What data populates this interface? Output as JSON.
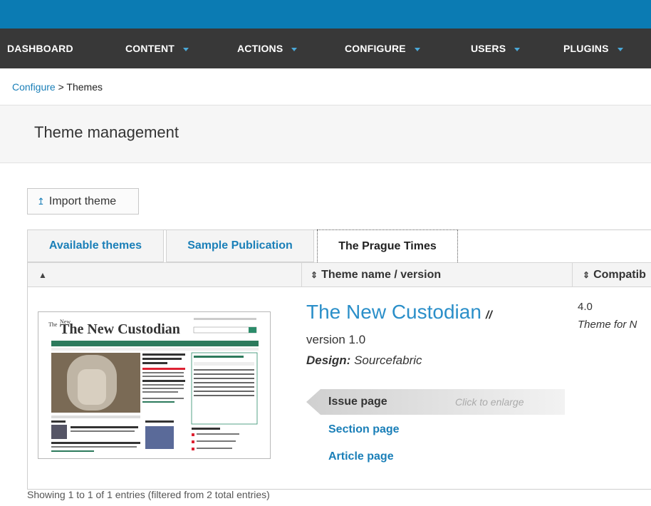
{
  "nav": {
    "items": [
      {
        "label": "DASHBOARD",
        "has_caret": false
      },
      {
        "label": "CONTENT",
        "has_caret": true
      },
      {
        "label": "ACTIONS",
        "has_caret": true
      },
      {
        "label": "CONFIGURE",
        "has_caret": true
      },
      {
        "label": "USERS",
        "has_caret": true
      },
      {
        "label": "PLUGINS",
        "has_caret": true
      }
    ]
  },
  "breadcrumb": {
    "parent": "Configure",
    "separator": ">",
    "current": "Themes"
  },
  "page_title": "Theme management",
  "import_button": {
    "label": "Import theme",
    "icon": "upload-icon"
  },
  "tabs": [
    {
      "label": "Available themes",
      "active": false
    },
    {
      "label": "Sample Publication",
      "active": false
    },
    {
      "label": "The Prague Times",
      "active": true
    }
  ],
  "table": {
    "columns": [
      {
        "label": "",
        "sort": "sorted-ascending"
      },
      {
        "label": "Theme name / version",
        "sort": "sortable"
      },
      {
        "label": "Compatib",
        "sort": "sortable"
      }
    ],
    "row": {
      "thumbnail_title": "The New Custodian",
      "theme_name": "The New Custodian",
      "version": "version 1.0",
      "design_label": "Design:",
      "designer": "Sourcefabric",
      "preview_tabs": {
        "issue_label": "Issue page",
        "issue_hint": "Click to enlarge",
        "section_label": "Section page",
        "article_label": "Article page"
      },
      "compat_version": "4.0",
      "compat_desc": "Theme for N"
    }
  },
  "footer_info": "Showing 1 to 1 of 1 entries (filtered from 2 total entries)",
  "colors": {
    "topbar": "#0b7bb3",
    "navbar": "#383838",
    "accent": "#1a7fb8",
    "caret": "#4aa8d8"
  }
}
